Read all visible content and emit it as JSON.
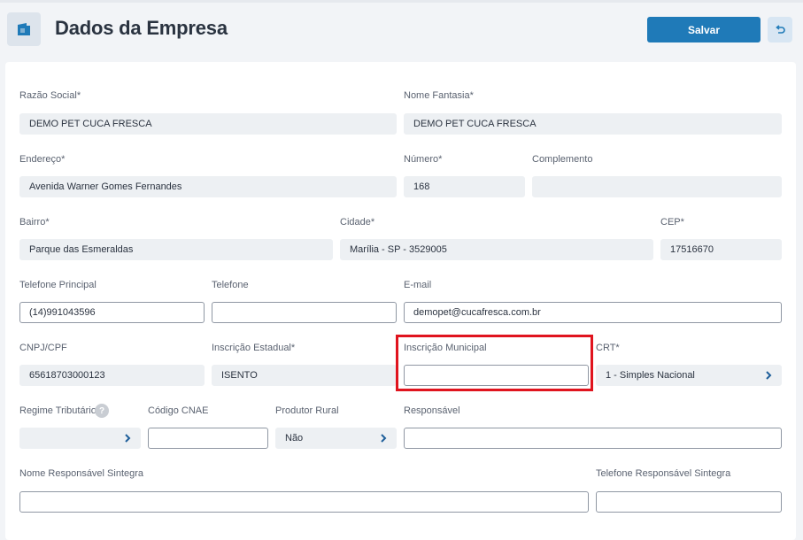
{
  "header": {
    "title": "Dados da Empresa",
    "save_label": "Salvar",
    "logo_icon": "store-icon",
    "back_icon": "undo-icon",
    "accent_color": "#1f7ab8"
  },
  "form": {
    "razao_social": {
      "label": "Razão Social*",
      "value": "DEMO PET CUCA FRESCA"
    },
    "nome_fantasia": {
      "label": "Nome Fantasia*",
      "value": "DEMO PET CUCA FRESCA"
    },
    "endereco": {
      "label": "Endereço*",
      "value": "Avenida Warner Gomes Fernandes"
    },
    "numero": {
      "label": "Número*",
      "value": "168"
    },
    "complemento": {
      "label": "Complemento",
      "value": ""
    },
    "bairro": {
      "label": "Bairro*",
      "value": "Parque das Esmeraldas"
    },
    "cidade": {
      "label": "Cidade*",
      "value": "Marília - SP - 3529005"
    },
    "cep": {
      "label": "CEP*",
      "value": "17516670"
    },
    "telefone_principal": {
      "label": "Telefone Principal",
      "value": "(14)991043596"
    },
    "telefone": {
      "label": "Telefone",
      "value": ""
    },
    "email": {
      "label": "E-mail",
      "value": "demopet@cucafresca.com.br"
    },
    "cnpj": {
      "label": "CNPJ/CPF",
      "value": "65618703000123"
    },
    "inscricao_estadual": {
      "label": "Inscrição Estadual*",
      "value": "ISENTO"
    },
    "inscricao_municipal": {
      "label": "Inscrição Municipal",
      "value": ""
    },
    "crt": {
      "label": "CRT*",
      "value": "1 - Simples Nacional"
    },
    "regime_tributario": {
      "label": "Regime Tributário",
      "value": "",
      "help": "?"
    },
    "codigo_cnae": {
      "label": "Código CNAE",
      "value": ""
    },
    "produtor_rural": {
      "label": "Produtor Rural",
      "value": "Não"
    },
    "responsavel": {
      "label": "Responsável",
      "value": ""
    },
    "nome_responsavel_sintegra": {
      "label": "Nome Responsável Sintegra",
      "value": ""
    },
    "telefone_responsavel_sintegra": {
      "label": "Telefone Responsável Sintegra",
      "value": ""
    }
  },
  "highlight_color": "#e0141e"
}
